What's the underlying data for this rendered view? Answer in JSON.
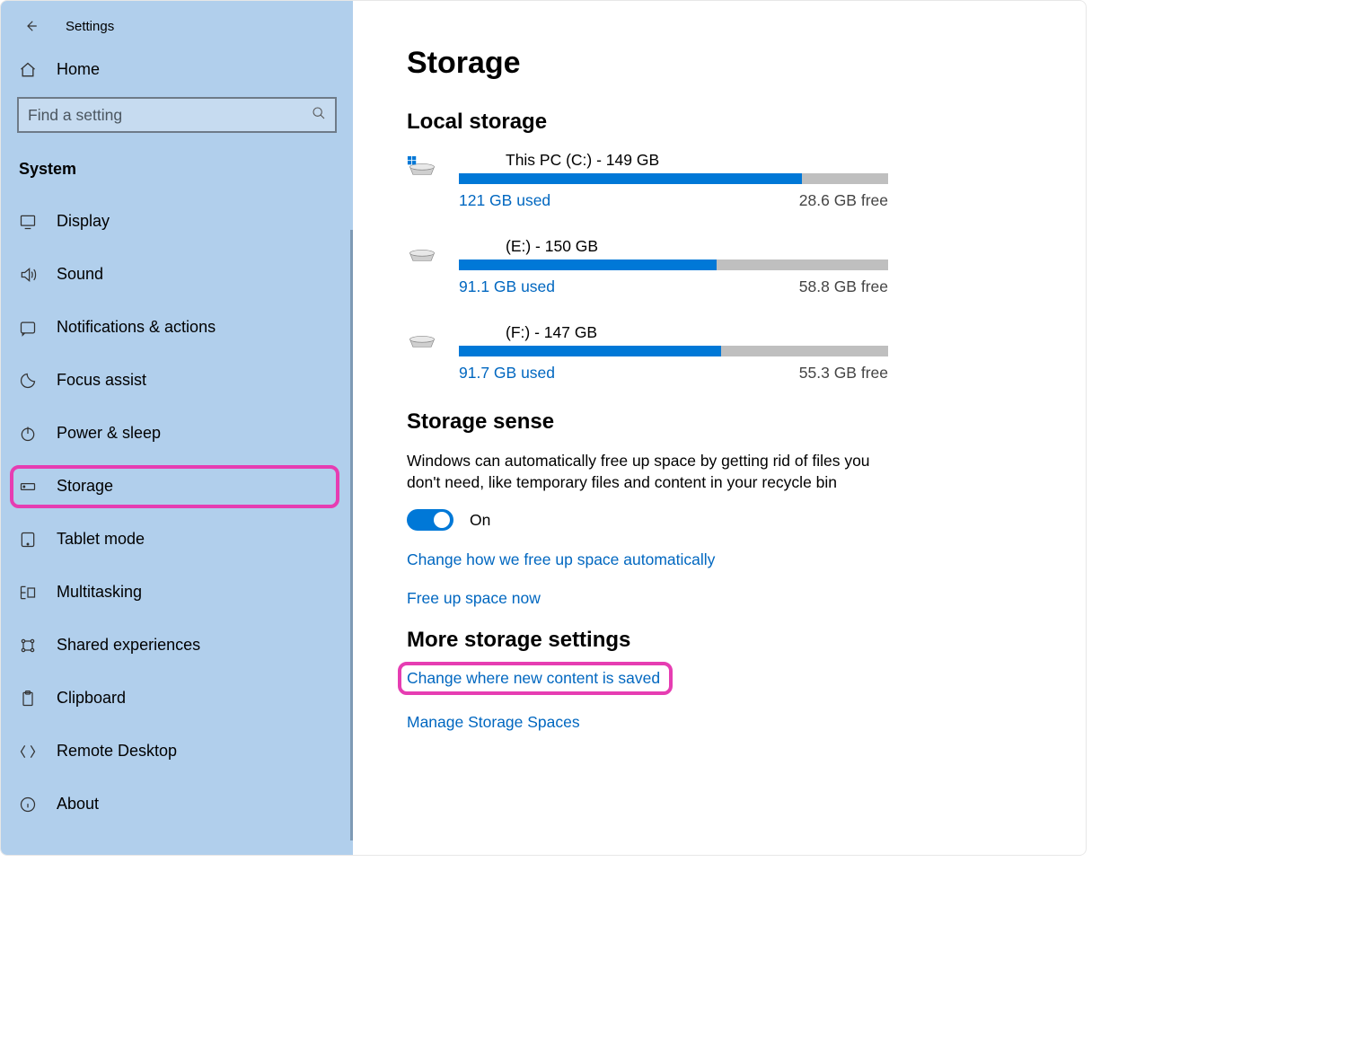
{
  "window_title": "Settings",
  "sidebar": {
    "home_label": "Home",
    "search_placeholder": "Find a setting",
    "section_label": "System",
    "items": [
      {
        "label": "Display",
        "icon": "display-icon"
      },
      {
        "label": "Sound",
        "icon": "sound-icon"
      },
      {
        "label": "Notifications & actions",
        "icon": "notifications-icon"
      },
      {
        "label": "Focus assist",
        "icon": "focus-assist-icon"
      },
      {
        "label": "Power & sleep",
        "icon": "power-icon"
      },
      {
        "label": "Storage",
        "icon": "storage-icon"
      },
      {
        "label": "Tablet mode",
        "icon": "tablet-icon"
      },
      {
        "label": "Multitasking",
        "icon": "multitasking-icon"
      },
      {
        "label": "Shared experiences",
        "icon": "shared-icon"
      },
      {
        "label": "Clipboard",
        "icon": "clipboard-icon"
      },
      {
        "label": "Remote Desktop",
        "icon": "remote-icon"
      },
      {
        "label": "About",
        "icon": "about-icon"
      }
    ],
    "selected_index": 5
  },
  "page": {
    "title": "Storage",
    "local_storage": {
      "heading": "Local storage",
      "drives": [
        {
          "title": "This PC (C:) - 149 GB",
          "used_label": "121 GB used",
          "free_label": "28.6 GB free",
          "fill_pct": 80,
          "is_system": true
        },
        {
          "title": "(E:) - 150 GB",
          "used_label": "91.1 GB used",
          "free_label": "58.8 GB free",
          "fill_pct": 60,
          "is_system": false
        },
        {
          "title": "(F:) - 147 GB",
          "used_label": "91.7 GB used",
          "free_label": "55.3 GB free",
          "fill_pct": 61,
          "is_system": false
        }
      ]
    },
    "storage_sense": {
      "heading": "Storage sense",
      "description": "Windows can automatically free up space by getting rid of files you don't need, like temporary files and content in your recycle bin",
      "toggle_on": true,
      "toggle_label": "On",
      "link_change": "Change how we free up space automatically",
      "link_freeup": "Free up space now"
    },
    "more_settings": {
      "heading": "More storage settings",
      "link_change_where": "Change where new content is saved",
      "link_manage_spaces": "Manage Storage Spaces"
    }
  },
  "annotations": {
    "highlight_nav_item_index": 5,
    "highlight_link": "link_change_where"
  }
}
